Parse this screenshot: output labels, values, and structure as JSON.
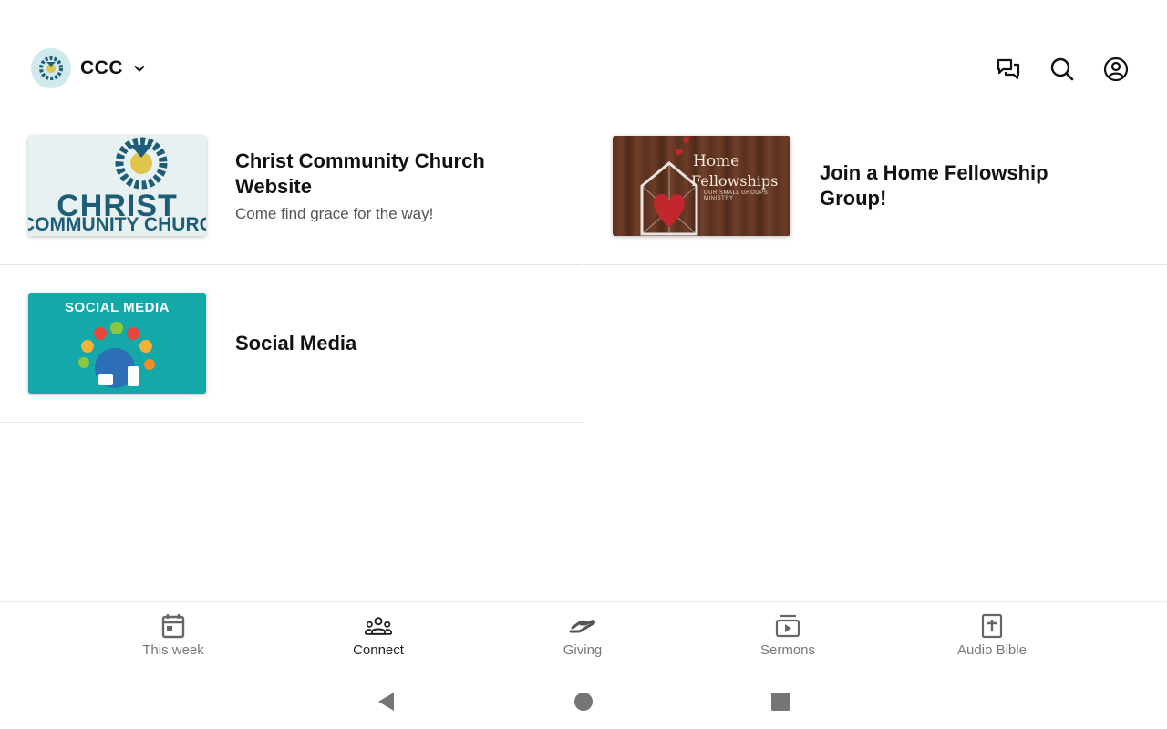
{
  "header": {
    "org_name": "CCC",
    "icons": [
      "chevron-down-icon",
      "chat-icon",
      "search-icon",
      "account-icon"
    ]
  },
  "cards": [
    {
      "title": "Christ Community Church Website",
      "subtitle": "Come find grace for the way!",
      "thumb_text": [
        "CHRIST",
        "COMMUNITY CHURCH"
      ]
    },
    {
      "title": "Join a Home Fellowship Group!",
      "subtitle": "",
      "thumb_text": [
        "Home",
        "Fellowships",
        "OUR SMALL GROUPS MINISTRY"
      ]
    },
    {
      "title": "Social Media",
      "subtitle": "",
      "thumb_text": [
        "SOCIAL MEDIA"
      ]
    }
  ],
  "bottom_nav": {
    "active": "Connect",
    "items": [
      {
        "label": "This week",
        "icon": "calendar-icon"
      },
      {
        "label": "Connect",
        "icon": "people-icon"
      },
      {
        "label": "Giving",
        "icon": "giving-hand-icon"
      },
      {
        "label": "Sermons",
        "icon": "video-library-icon"
      },
      {
        "label": "Audio Bible",
        "icon": "bible-icon"
      }
    ]
  },
  "system_nav": [
    "back-icon",
    "home-icon",
    "recents-icon"
  ],
  "colors": {
    "text_primary": "#111111",
    "text_secondary": "#555555",
    "nav_inactive": "#777777",
    "divider": "#e4e4e4",
    "brand_teal": "#1d5d78",
    "social_teal": "#14a8a8"
  }
}
